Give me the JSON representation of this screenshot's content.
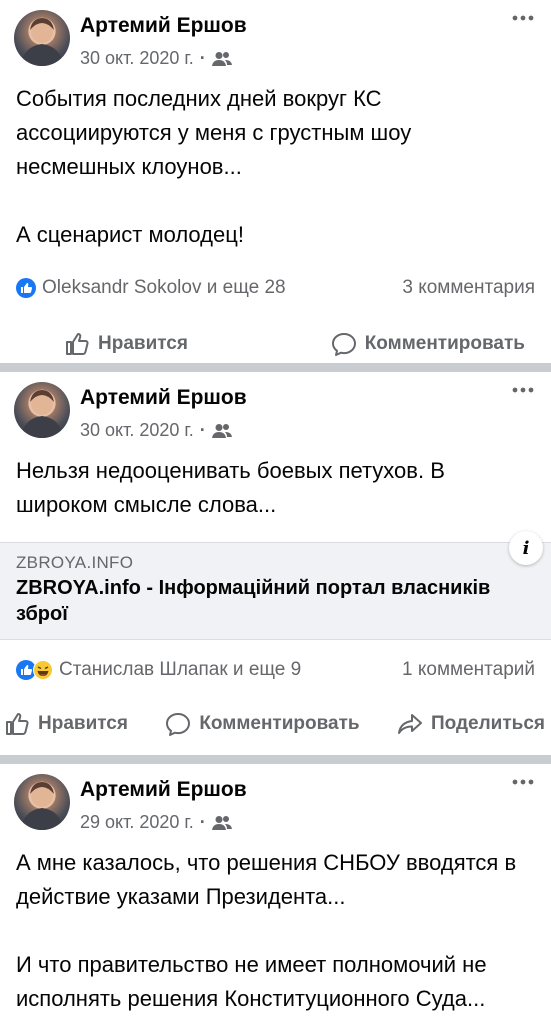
{
  "posts": [
    {
      "author": "Артемий Ершов",
      "date": "30 окт. 2020 г.",
      "dot": "·",
      "paragraphs": [
        "События последних дней вокруг КС ассоциируются у меня с грустным шоу несмешных клоунов...",
        "А сценарист молодец!"
      ],
      "reactions": "Oleksandr Sokolov и еще 28",
      "comments": "3 комментария",
      "like_label": "Нравится",
      "comment_label": "Комментировать"
    },
    {
      "author": "Артемий Ершов",
      "date": "30 окт. 2020 г.",
      "dot": "·",
      "paragraphs": [
        "Нельзя недооценивать боевых петухов. В широком смысле слова..."
      ],
      "link": {
        "domain": "ZBROYA.INFO",
        "title": "ZBROYA.info - Інформаційний портал власників зброї",
        "info_glyph": "i"
      },
      "reactions": "Станислав Шлапак и еще 9",
      "comments": "1 комментарий",
      "like_label": "Нравится",
      "comment_label": "Комментировать",
      "share_label": "Поделиться"
    },
    {
      "author": "Артемий Ершов",
      "date": "29 окт. 2020 г.",
      "dot": "·",
      "paragraphs": [
        "А мне казалось, что решения СНБОУ вводятся в действие указами Президента...",
        "И что правительство не имеет полномочий не исполнять решения Конституционного Суда..."
      ]
    }
  ],
  "icons": {
    "more": "more-horizontal-icon",
    "audience": "friends-icon",
    "like_reaction": "like-reaction-icon",
    "haha_reaction": "haha-reaction-icon",
    "like_action": "thumbs-up-icon",
    "comment_action": "comment-bubble-icon",
    "share_action": "share-arrow-icon",
    "info": "info-icon"
  },
  "colors": {
    "text": "#050505",
    "secondary": "#65676b",
    "like_blue": "#1877f2",
    "separator": "#c9ccd1",
    "link_bg": "#f0f2f5"
  }
}
